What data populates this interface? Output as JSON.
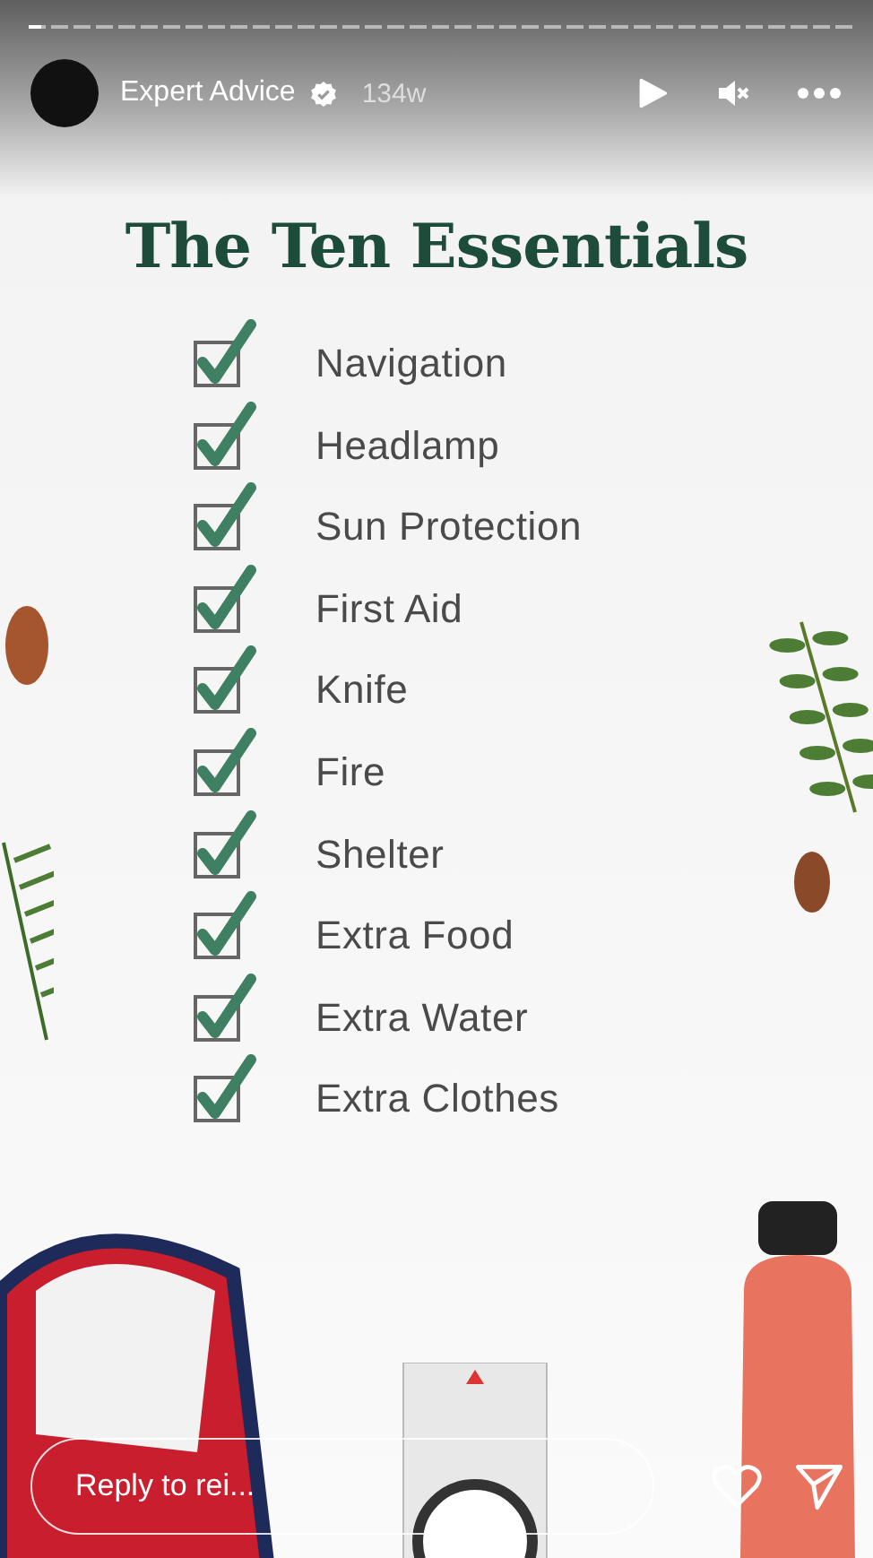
{
  "story_progress": {
    "level": 0.015
  },
  "header": {
    "account": "Expert Advice",
    "verified": true,
    "time": "134w",
    "playing": false,
    "muted": true
  },
  "story": {
    "title": "The Ten Essentials",
    "items": [
      {
        "label": "Navigation",
        "checked": true
      },
      {
        "label": "Headlamp",
        "checked": true
      },
      {
        "label": "Sun Protection",
        "checked": true
      },
      {
        "label": "First Aid",
        "checked": true
      },
      {
        "label": "Knife",
        "checked": true
      },
      {
        "label": "Fire",
        "checked": true
      },
      {
        "label": "Shelter",
        "checked": true
      },
      {
        "label": "Extra Food",
        "checked": true
      },
      {
        "label": "Extra Water",
        "checked": true
      },
      {
        "label": "Extra Clothes",
        "checked": true
      }
    ]
  },
  "reply": {
    "placeholder": "Reply to rei..."
  }
}
